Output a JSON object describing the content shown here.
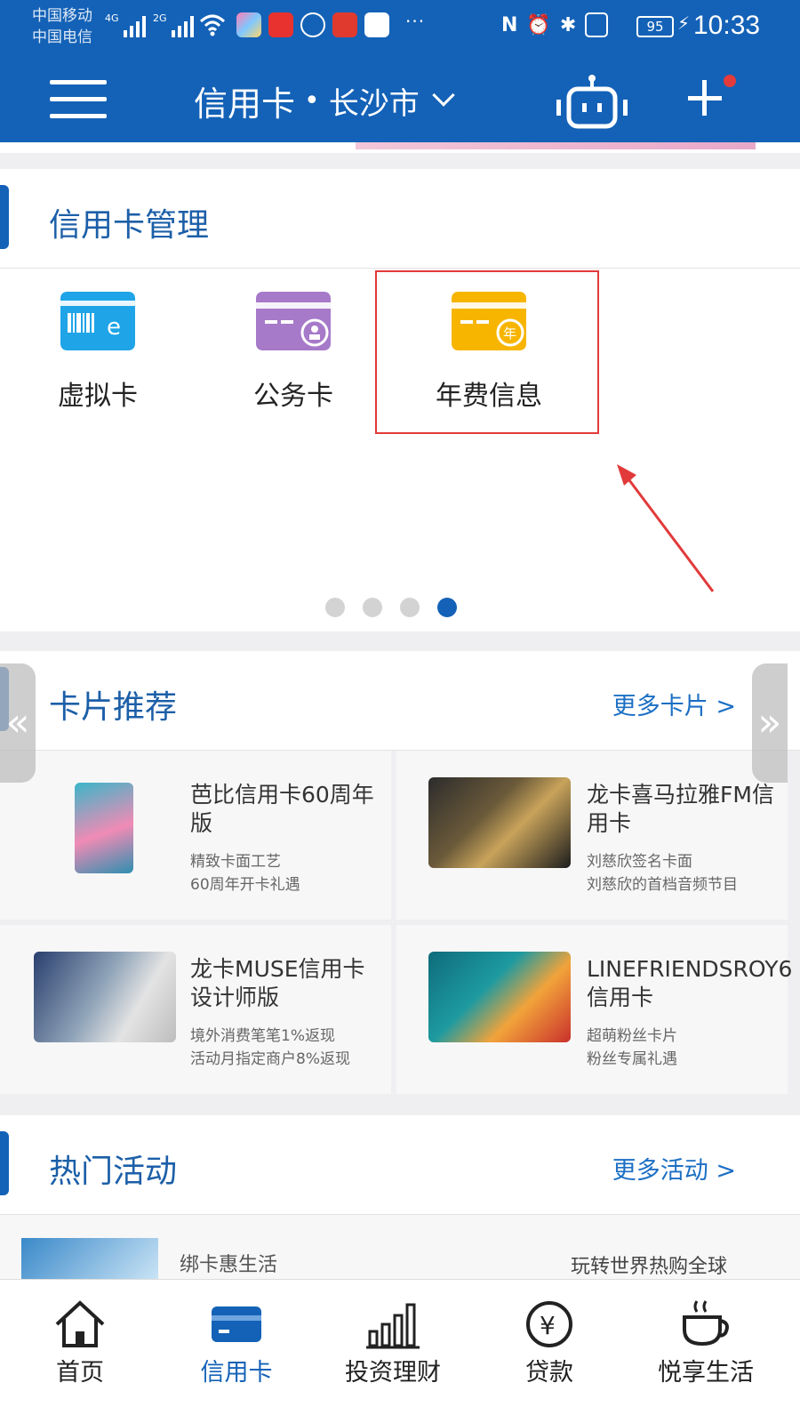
{
  "status_bar": {
    "carrier1": "中国移动",
    "carrier2": "中国电信",
    "sig1_tag": "4G",
    "sig2_tag": "2G",
    "more": "···",
    "battery": "95",
    "time": "10:33"
  },
  "header": {
    "title": "信用卡",
    "separator": "•",
    "city": "长沙市"
  },
  "management": {
    "title": "信用卡管理",
    "items": [
      {
        "label": "虚拟卡",
        "icon": "virtual-card-icon",
        "color": "#1fa4e8"
      },
      {
        "label": "公务卡",
        "icon": "business-card-icon",
        "color": "#a679c9"
      },
      {
        "label": "年费信息",
        "icon": "annual-fee-icon",
        "color": "#f7b500"
      }
    ],
    "annual_badge": "年",
    "pager_active": 4,
    "pager_total": 4
  },
  "recommend": {
    "title": "卡片推荐",
    "more": "更多卡片 >",
    "cards": [
      {
        "name": "芭比信用卡60周年版",
        "desc1": "精致卡面工艺",
        "desc2": "60周年开卡礼遇"
      },
      {
        "name": "龙卡喜马拉雅FM信用卡",
        "desc1": "刘慈欣签名卡面",
        "desc2": "刘慈欣的首档音频节目"
      },
      {
        "name": "龙卡MUSE信用卡设计师版",
        "desc1": "境外消费笔笔1%返现",
        "desc2": "活动月指定商户8%返现"
      },
      {
        "name": "LINEFRIENDSROY6信用卡",
        "desc1": "超萌粉丝卡片",
        "desc2": "粉丝专属礼遇"
      }
    ]
  },
  "hot": {
    "title": "热门活动",
    "more": "更多活动 >",
    "item1": "绑卡惠生活",
    "item2": "玩转世界热购全球"
  },
  "tabbar": {
    "tabs": [
      {
        "label": "首页",
        "icon": "home-icon"
      },
      {
        "label": "信用卡",
        "icon": "credit-card-icon"
      },
      {
        "label": "投资理财",
        "icon": "bar-chart-icon"
      },
      {
        "label": "贷款",
        "icon": "yen-coin-icon"
      },
      {
        "label": "悦享生活",
        "icon": "coffee-cup-icon"
      }
    ],
    "active_index": 1
  },
  "colors": {
    "brand": "#1462b7",
    "highlight": "#e23a3a"
  }
}
